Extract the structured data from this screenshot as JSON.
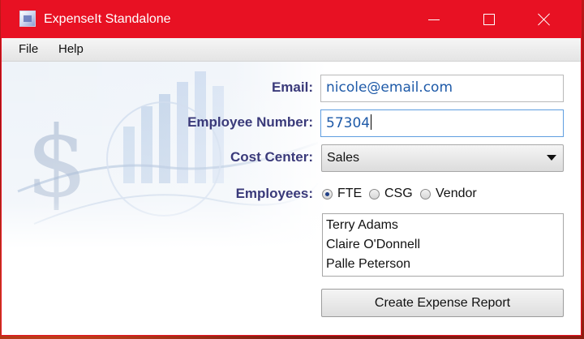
{
  "window": {
    "title": "ExpenseIt Standalone",
    "accent": "#e81123"
  },
  "menu": {
    "items": [
      "File",
      "Help"
    ]
  },
  "form": {
    "email_label": "Email:",
    "email_value": "nicole@email.com",
    "employee_number_label": "Employee Number:",
    "employee_number_value": "57304",
    "cost_center_label": "Cost Center:",
    "cost_center_value": "Sales",
    "employees_label": "Employees:",
    "employee_types": [
      {
        "label": "FTE",
        "checked": true
      },
      {
        "label": "CSG",
        "checked": false
      },
      {
        "label": "Vendor",
        "checked": false
      }
    ],
    "employees_list": [
      "Terry Adams",
      "Claire O'Donnell",
      "Palle Peterson"
    ],
    "create_button_label": "Create Expense Report"
  },
  "colors": {
    "label_text": "#3a3a7a",
    "value_text": "#1e5aa8",
    "focus_border": "#5f9ee0"
  }
}
